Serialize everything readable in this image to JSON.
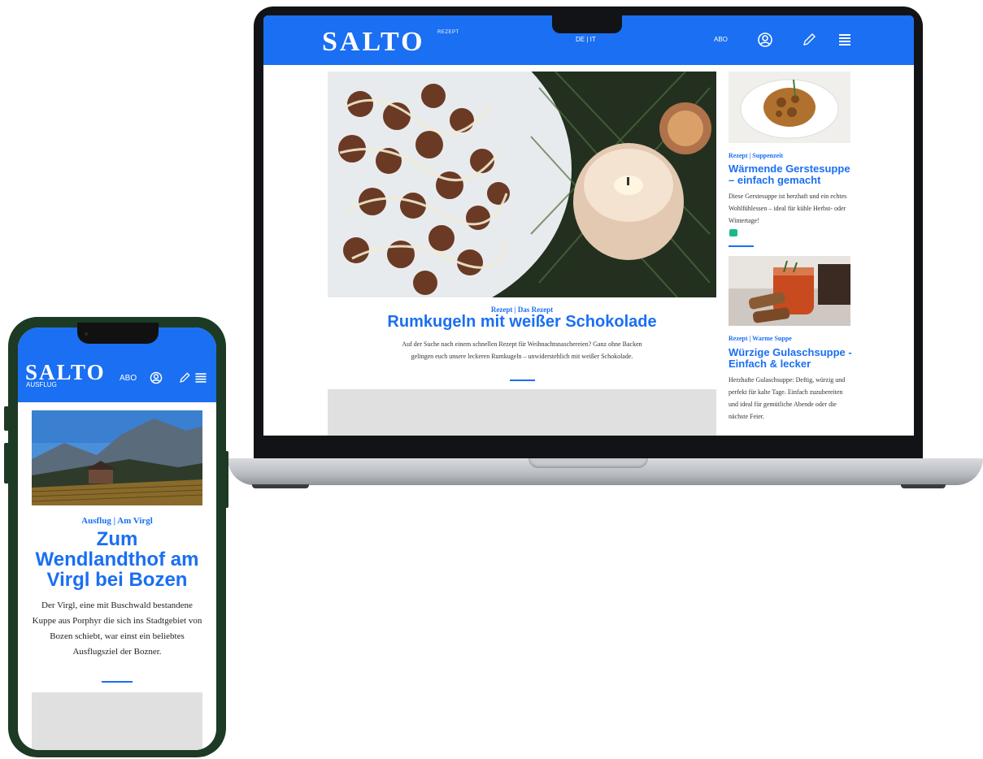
{
  "colors": {
    "brand_blue": "#1a6ff2",
    "comment_green": "#19b98a",
    "ad_gray": "#e0e0e0"
  },
  "laptop": {
    "header": {
      "logo": "SALTO",
      "section": "REZEPT",
      "language": "DE | IT",
      "abo": "ABO",
      "icons": [
        "user-circle-icon",
        "pencil-icon",
        "hamburger-menu-icon"
      ]
    },
    "main_article": {
      "category": "Rezept | Das Rezept",
      "title": "Rumkugeln mit weißer Schokolade",
      "teaser": "Auf der Suche nach einem schnellen Rezept für Weihnachtsnaschereien? Ganz ohne Backen gelingen euch unsere leckeren Rumkugeln – unwiderstehlich mit weißer Schokolade."
    },
    "sidebar": [
      {
        "category": "Rezept | Suppenzeit",
        "title": "Wärmende Gerstesuppe – einfach gemacht",
        "teaser": "Diese Gerstesuppe ist herzhaft und ein echtes Wohlfühlessen – ideal für kühle Herbst- oder Wintertage!"
      },
      {
        "category": "Rezept | Warme Suppe",
        "title": "Würzige Gulaschsuppe - Einfach & lecker",
        "teaser": "Herzhafte Gulaschsuppe: Deftig, würzig und perfekt für kalte Tage. Einfach zuzubereiten und ideal für gemütliche Abende oder die nächste Feier."
      }
    ]
  },
  "phone": {
    "header": {
      "logo": "SALTO",
      "section": "AUSFLUG",
      "abo": "ABO",
      "icons": [
        "user-circle-icon",
        "pencil-icon",
        "hamburger-menu-icon"
      ]
    },
    "article": {
      "category": "Ausflug | Am Virgl",
      "title": "Zum Wendlandthof am Virgl bei Bozen",
      "teaser": "Der Virgl, eine mit Buschwald bestandene Kuppe aus Porphyr die sich ins Stadtgebiet von Bozen schiebt, war einst ein beliebtes Ausflugsziel der Bozner."
    }
  }
}
